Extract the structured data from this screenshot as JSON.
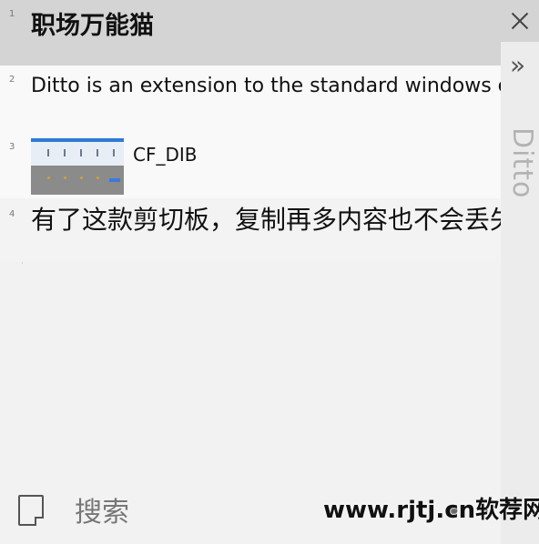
{
  "clips": [
    {
      "index": "1",
      "text": "职场万能猫"
    },
    {
      "index": "2",
      "text": "Ditto is an extension to the standard windows clipboard"
    },
    {
      "index": "3",
      "format": "CF_DIB"
    },
    {
      "index": "4",
      "text": "有了这款剪切板，复制再多内容也不会丢失"
    }
  ],
  "sidebar": {
    "title": "Ditto",
    "close_icon": "close-icon",
    "expand_icon": "double-chevron-right-icon",
    "expand_glyph": "»"
  },
  "bottom": {
    "search_placeholder": "搜索",
    "more_glyph": "• •",
    "watermark": "www.rjtj.cn软荐网"
  },
  "colors": {
    "selected_row": "#d4d4d4",
    "list_bg": "#f9f9f9",
    "title_text": "#b3b3b3"
  }
}
